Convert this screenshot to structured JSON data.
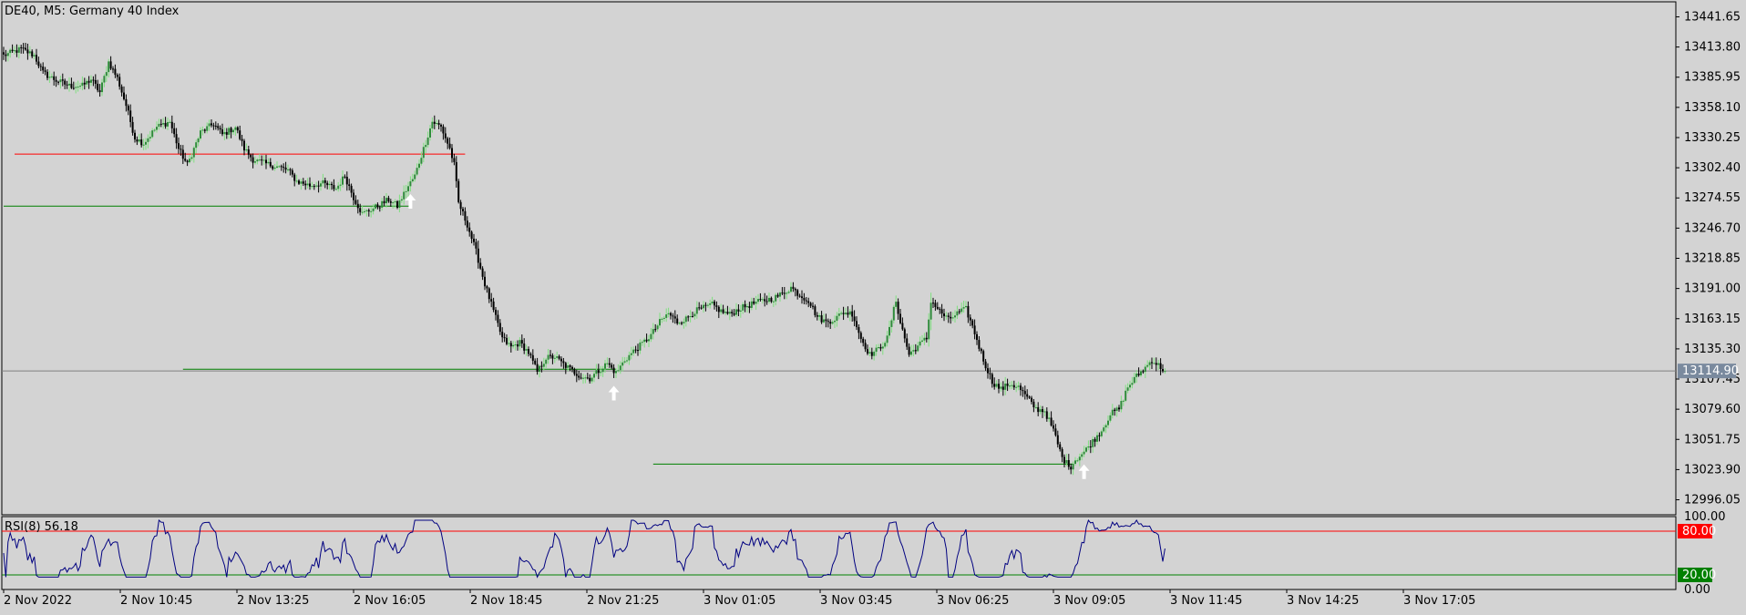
{
  "colors": {
    "background": "#d3d3d3",
    "frame": "#000000",
    "bull_candle": "#2e8b3a",
    "bear_candle": "#000000",
    "bull_wick": "#7fe07f",
    "red_line": "#ff0000",
    "green_line": "#008000",
    "rsi_line": "#000080",
    "current_price_line": "#808080",
    "current_price_tag": "#7a8a9e",
    "upper_level_tag": "#ff0000",
    "lower_level_tag": "#008000",
    "arrow": "#ffffff"
  },
  "chart_data": [
    {
      "type": "candlestick",
      "title": "DE40, M5:  Germany 40 Index",
      "symbol": "DE40",
      "timeframe": "M5",
      "instrument": "Germany 40 Index",
      "ylim": [
        12982.2,
        13455.5
      ],
      "yticks": [
        "13441.65",
        "13413.80",
        "13385.95",
        "13358.10",
        "13330.25",
        "13302.40",
        "13274.55",
        "13246.70",
        "13218.85",
        "13191.00",
        "13163.15",
        "13135.30",
        "13107.45",
        "13079.60",
        "13051.75",
        "13023.90",
        "12996.05"
      ],
      "xticks": [
        "2 Nov 2022",
        "2 Nov 10:45",
        "2 Nov 13:25",
        "2 Nov 16:05",
        "2 Nov 18:45",
        "2 Nov 21:25",
        "3 Nov 01:05",
        "3 Nov 03:45",
        "3 Nov 06:25",
        "3 Nov 09:05",
        "3 Nov 11:45",
        "3 Nov 14:25",
        "3 Nov 17:05"
      ],
      "current_price": 13114.9,
      "current_price_label": "13114.90",
      "path_anchors": [
        [
          0,
          13406
        ],
        [
          8,
          13412
        ],
        [
          14,
          13406
        ],
        [
          18,
          13390
        ],
        [
          24,
          13383
        ],
        [
          30,
          13378
        ],
        [
          36,
          13378
        ],
        [
          40,
          13384
        ],
        [
          44,
          13372
        ],
        [
          48,
          13400
        ],
        [
          52,
          13385
        ],
        [
          56,
          13360
        ],
        [
          60,
          13330
        ],
        [
          64,
          13325
        ],
        [
          70,
          13340
        ],
        [
          76,
          13345
        ],
        [
          80,
          13320
        ],
        [
          84,
          13305
        ],
        [
          90,
          13335
        ],
        [
          96,
          13343
        ],
        [
          100,
          13333
        ],
        [
          106,
          13340
        ],
        [
          110,
          13320
        ],
        [
          114,
          13310
        ],
        [
          120,
          13306
        ],
        [
          126,
          13303
        ],
        [
          130,
          13300
        ],
        [
          134,
          13290
        ],
        [
          140,
          13286
        ],
        [
          146,
          13288
        ],
        [
          152,
          13283
        ],
        [
          156,
          13295
        ],
        [
          160,
          13275
        ],
        [
          164,
          13260
        ],
        [
          168,
          13264
        ],
        [
          172,
          13268
        ],
        [
          176,
          13273
        ],
        [
          180,
          13267
        ],
        [
          184,
          13282
        ],
        [
          188,
          13295
        ],
        [
          192,
          13320
        ],
        [
          196,
          13345
        ],
        [
          200,
          13340
        ],
        [
          204,
          13320
        ],
        [
          206,
          13305
        ],
        [
          208,
          13270
        ],
        [
          212,
          13250
        ],
        [
          216,
          13225
        ],
        [
          220,
          13195
        ],
        [
          224,
          13170
        ],
        [
          228,
          13145
        ],
        [
          232,
          13137
        ],
        [
          236,
          13141
        ],
        [
          240,
          13132
        ],
        [
          244,
          13114
        ],
        [
          248,
          13127
        ],
        [
          252,
          13128
        ],
        [
          256,
          13121
        ],
        [
          260,
          13115
        ],
        [
          264,
          13110
        ],
        [
          268,
          13108
        ],
        [
          272,
          13115
        ],
        [
          276,
          13122
        ],
        [
          280,
          13113
        ],
        [
          284,
          13125
        ],
        [
          288,
          13133
        ],
        [
          292,
          13140
        ],
        [
          296,
          13148
        ],
        [
          300,
          13160
        ],
        [
          304,
          13168
        ],
        [
          308,
          13160
        ],
        [
          312,
          13163
        ],
        [
          316,
          13170
        ],
        [
          320,
          13173
        ],
        [
          324,
          13176
        ],
        [
          328,
          13170
        ],
        [
          332,
          13167
        ],
        [
          336,
          13172
        ],
        [
          340,
          13175
        ],
        [
          344,
          13178
        ],
        [
          348,
          13180
        ],
        [
          352,
          13182
        ],
        [
          356,
          13186
        ],
        [
          360,
          13192
        ],
        [
          364,
          13185
        ],
        [
          368,
          13180
        ],
        [
          372,
          13165
        ],
        [
          376,
          13160
        ],
        [
          380,
          13163
        ],
        [
          384,
          13169
        ],
        [
          388,
          13168
        ],
        [
          392,
          13145
        ],
        [
          396,
          13130
        ],
        [
          400,
          13135
        ],
        [
          404,
          13145
        ],
        [
          408,
          13180
        ],
        [
          410,
          13160
        ],
        [
          414,
          13130
        ],
        [
          418,
          13138
        ],
        [
          422,
          13145
        ],
        [
          424,
          13180
        ],
        [
          428,
          13170
        ],
        [
          432,
          13162
        ],
        [
          436,
          13168
        ],
        [
          440,
          13172
        ],
        [
          444,
          13150
        ],
        [
          448,
          13125
        ],
        [
          452,
          13105
        ],
        [
          456,
          13098
        ],
        [
          460,
          13103
        ],
        [
          464,
          13100
        ],
        [
          468,
          13090
        ],
        [
          472,
          13080
        ],
        [
          476,
          13078
        ],
        [
          480,
          13060
        ],
        [
          484,
          13035
        ],
        [
          486,
          13030
        ],
        [
          488,
          13027
        ],
        [
          490,
          13033
        ],
        [
          494,
          13040
        ],
        [
          498,
          13050
        ],
        [
          502,
          13060
        ],
        [
          506,
          13075
        ],
        [
          510,
          13080
        ],
        [
          514,
          13100
        ],
        [
          518,
          13110
        ],
        [
          522,
          13118
        ],
        [
          525,
          13125
        ],
        [
          528,
          13120
        ],
        [
          531,
          13115
        ]
      ],
      "arrow_bars": [
        186,
        279,
        494
      ],
      "horizontal_lines": [
        {
          "color": "red",
          "price": 13315.0,
          "from_bar": 5,
          "to_bar": 211
        },
        {
          "color": "green",
          "price": 13267.0,
          "from_bar": 0,
          "to_bar": 186
        },
        {
          "color": "green",
          "price": 13116.5,
          "from_bar": 82,
          "to_bar": 280
        },
        {
          "color": "green",
          "price": 13029.0,
          "from_bar": 297,
          "to_bar": 489
        }
      ]
    },
    {
      "type": "line",
      "title": "RSI(8) 56.18",
      "indicator": "RSI",
      "period": 8,
      "last_value": 56.18,
      "ylim": [
        0,
        100
      ],
      "yticks": [
        "100.00",
        "0.00"
      ],
      "levels": [
        {
          "label": "80.00",
          "value": 80
        },
        {
          "label": "20.00",
          "value": 20
        }
      ]
    }
  ]
}
